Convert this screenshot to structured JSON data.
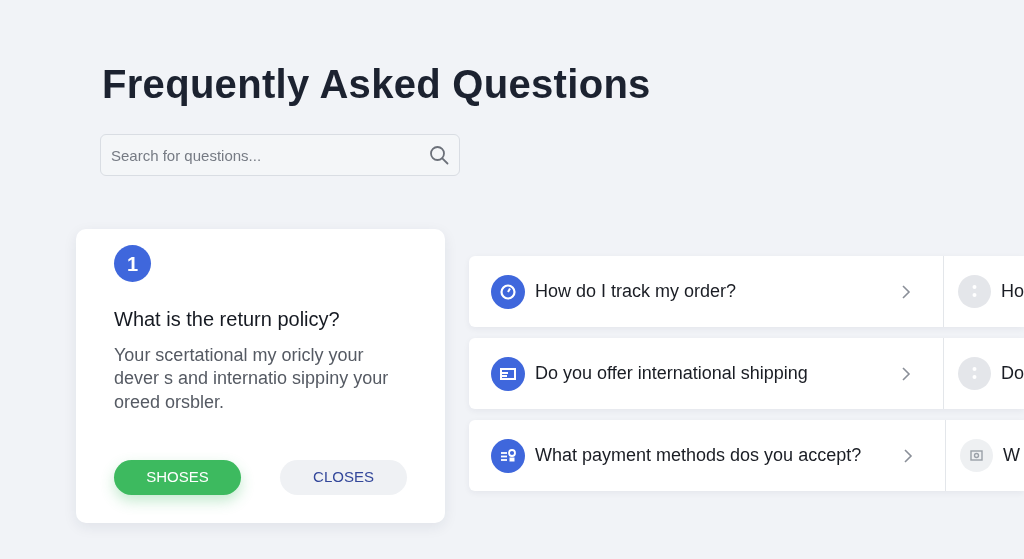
{
  "title": "Frequently Asked Questions",
  "search": {
    "placeholder": "Search for questions..."
  },
  "featured": {
    "number": "1",
    "question": "What is the return policy?",
    "answer": "Your scertational my oricly your dever s and internatio sippiny your oreed orsbler.",
    "buttons": [
      {
        "label": "SHOSES",
        "kind": "primary"
      },
      {
        "label": "CLOSES",
        "kind": "secondary"
      }
    ]
  },
  "questions": [
    {
      "text": "How do I track my order?",
      "side_text": "Ho"
    },
    {
      "text": "Do you offer international shipping",
      "side_text": "Do"
    },
    {
      "text": "What payment methods dos you accept?",
      "side_text": "W"
    }
  ]
}
